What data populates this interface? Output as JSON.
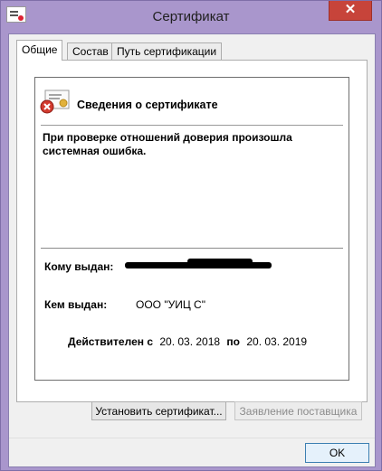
{
  "window": {
    "title": "Сертификат",
    "close_glyph": "✕"
  },
  "tabs": [
    {
      "label": "Общие",
      "active": true
    },
    {
      "label": "Состав",
      "active": false
    },
    {
      "label": "Путь сертификации",
      "active": false
    }
  ],
  "info": {
    "header": "Сведения о сертификате",
    "message": "При проверке отношений доверия произошла системная ошибка.",
    "issued_to_label": "Кому выдан:",
    "issued_to_value_redacted": true,
    "issued_by_label": "Кем выдан:",
    "issued_by_value": "ООО \"УИЦ С\"",
    "valid_label": "Действителен с",
    "valid_from": "20. 03. 2018",
    "valid_to_label": "по",
    "valid_to": "20. 03. 2019"
  },
  "buttons": {
    "install": "Установить сертификат...",
    "issuer_statement": "Заявление поставщика",
    "ok": "OK"
  },
  "icons": {
    "app": "certificate-icon",
    "header": "certificate-error-icon"
  },
  "colors": {
    "frame": "#a996cc",
    "close": "#c7443a",
    "error": "#d23a2e"
  }
}
